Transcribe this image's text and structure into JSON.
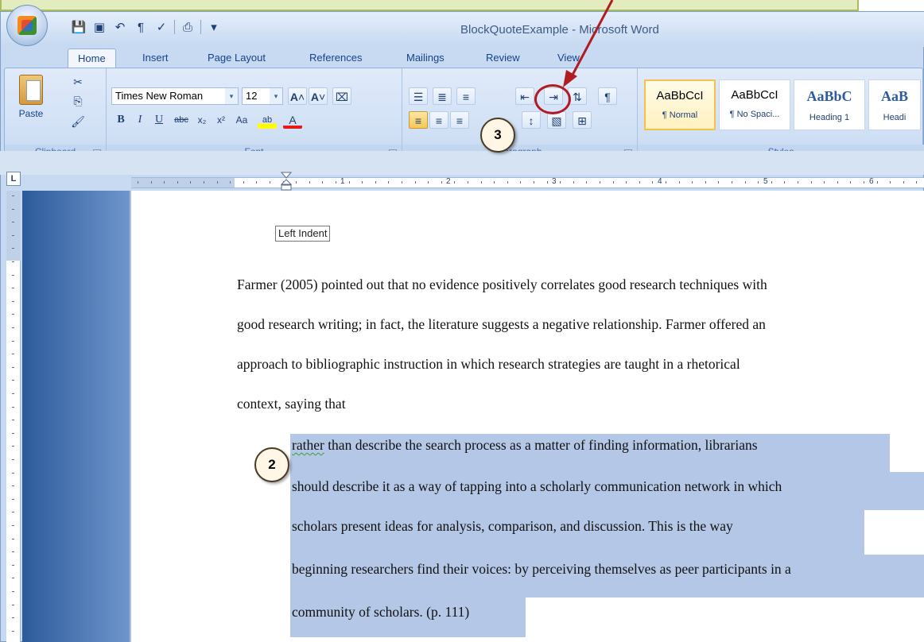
{
  "window": {
    "title": "BlockQuoteExample - Microsoft Word"
  },
  "tabs": [
    {
      "label": "Home"
    },
    {
      "label": "Insert"
    },
    {
      "label": "Page Layout"
    },
    {
      "label": "References"
    },
    {
      "label": "Mailings"
    },
    {
      "label": "Review"
    },
    {
      "label": "View"
    }
  ],
  "ribbon": {
    "clipboard": {
      "label": "Clipboard",
      "paste": "Paste"
    },
    "font": {
      "label": "Font",
      "family": "Times New Roman",
      "size": "12"
    },
    "paragraph": {
      "label": "Paragraph"
    },
    "styles": {
      "label": "Styles",
      "items": [
        {
          "sample": "AaBbCcI",
          "name": "¶ Normal"
        },
        {
          "sample": "AaBbCcI",
          "name": "¶ No Spaci..."
        },
        {
          "sample": "AaBbC",
          "name": "Heading 1"
        },
        {
          "sample": "AaB",
          "name": "Headi"
        }
      ]
    }
  },
  "ruler": {
    "numbers": [
      "1",
      "2",
      "3",
      "4",
      "5",
      "6"
    ],
    "tab_selector": "L"
  },
  "tooltip": "Left Indent",
  "document": {
    "paragraph": [
      "Farmer (2005) pointed out that no evidence positively correlates good research techniques with",
      "good research writing; in fact, the literature suggests a negative relationship.  Farmer offered an",
      "approach to bibliographic instruction in which research strategies are taught in a rhetorical",
      "context, saying that"
    ],
    "quote_first_word": "rather",
    "quote": [
      " than describe the search process as a matter of finding information, librarians",
      "should describe it as a way of tapping into a scholarly communication network in which",
      "scholars present ideas for analysis, comparison, and discussion.  This is the way",
      "beginning researchers find their voices: by perceiving themselves as peer participants in a",
      "community of scholars. (p. 111)"
    ]
  },
  "callouts": {
    "step2": "2",
    "step3": "3"
  }
}
